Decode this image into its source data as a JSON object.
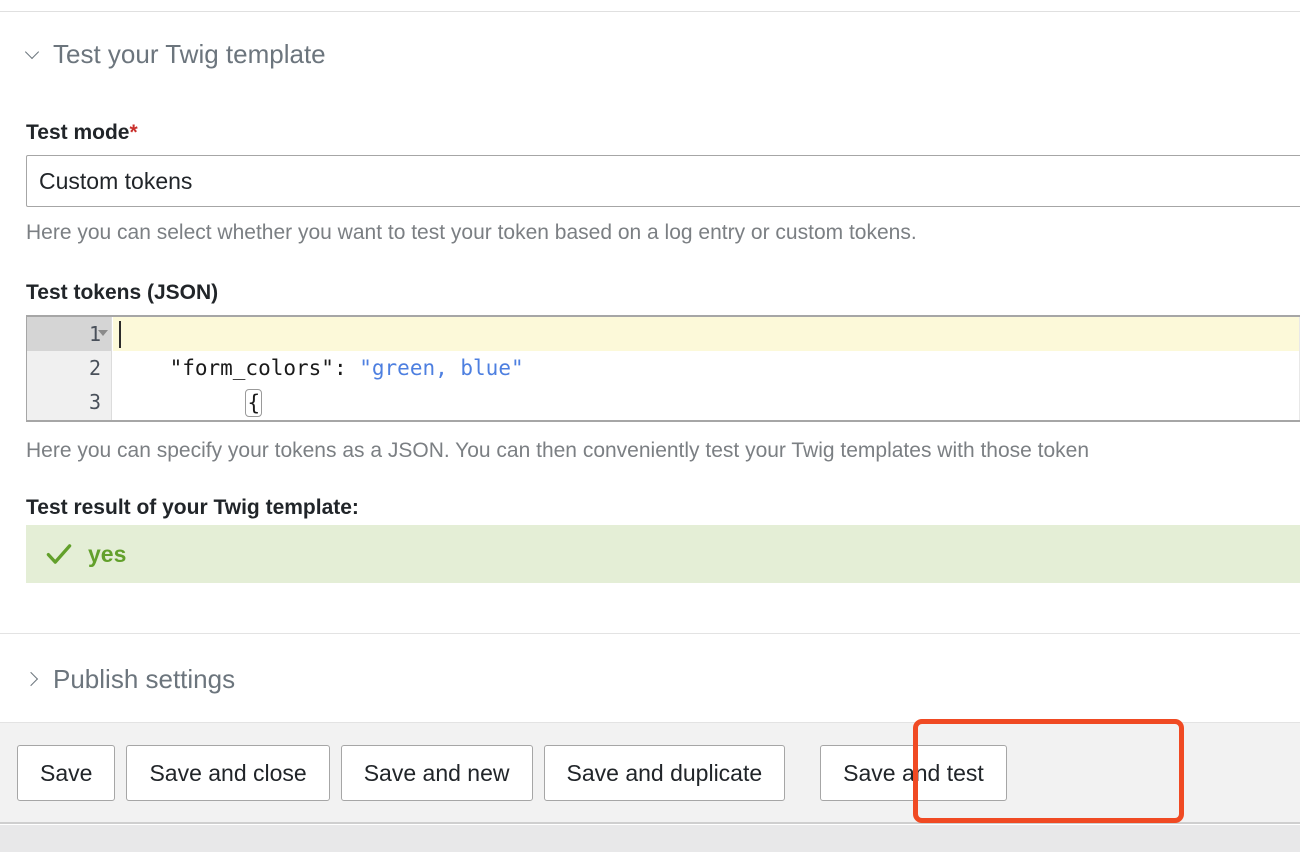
{
  "sections": {
    "test": {
      "title": "Test your Twig template",
      "expanded": true,
      "chevron_icon": "chevron-down-icon"
    },
    "publish": {
      "title": "Publish settings",
      "expanded": false,
      "chevron_icon": "chevron-right-icon"
    }
  },
  "fields": {
    "test_mode": {
      "label": "Test mode",
      "required_marker": "*",
      "value": "Custom tokens",
      "help": "Here you can select whether you want to test your token based on a log entry or custom tokens."
    },
    "test_tokens": {
      "label": "Test tokens (JSON)",
      "help": "Here you can specify your tokens as a JSON. You can then conveniently test your Twig templates with those token",
      "editor": {
        "gutter": [
          "1",
          "2",
          "3"
        ],
        "active_line": 1,
        "lines": [
          {
            "prefix": "",
            "brace": "{",
            "key": "",
            "sep": "",
            "value": ""
          },
          {
            "prefix": "    ",
            "brace": "",
            "key": "\"form_colors\"",
            "sep": ": ",
            "value": "\"green, blue\""
          },
          {
            "prefix": "",
            "brace": "}",
            "key": "",
            "sep": "",
            "value": ""
          }
        ],
        "string_color": "#4d7fe0",
        "active_line_color": "#fcf9d9"
      }
    }
  },
  "result": {
    "label": "Test result of your Twig template:",
    "status_icon": "check-icon",
    "status_text": "yes",
    "status_color": "#62a02b",
    "background_color": "#e4eed6"
  },
  "actionbar": {
    "buttons": [
      {
        "label": "Save",
        "highlighted": false
      },
      {
        "label": "Save and close",
        "highlighted": false
      },
      {
        "label": "Save and new",
        "highlighted": false
      },
      {
        "label": "Save and duplicate",
        "highlighted": false
      },
      {
        "label": "Save and test",
        "highlighted": true
      }
    ],
    "highlight_color": "#f04a23"
  }
}
